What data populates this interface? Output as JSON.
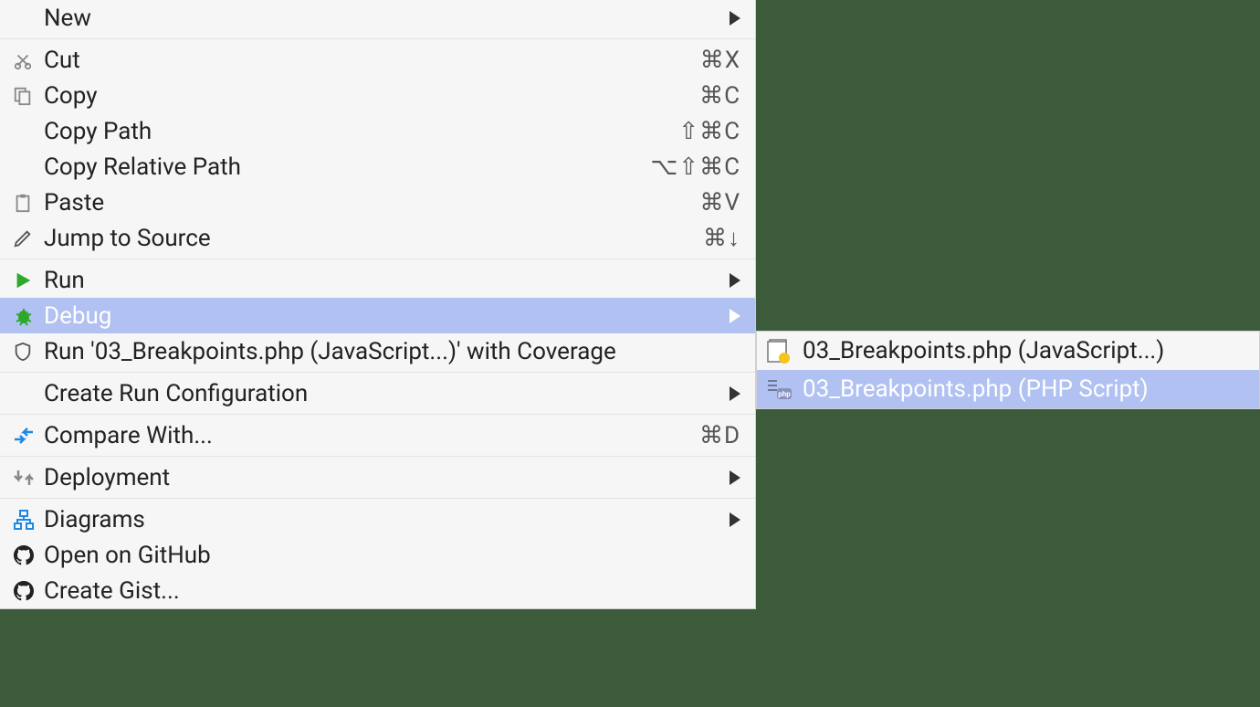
{
  "menu": {
    "new": {
      "label": "New"
    },
    "cut": {
      "label": "Cut",
      "shortcut": "⌘X"
    },
    "copy": {
      "label": "Copy",
      "shortcut": "⌘C"
    },
    "copy_path": {
      "label": "Copy Path",
      "shortcut": "⇧⌘C"
    },
    "copy_relative_path": {
      "label": "Copy Relative Path",
      "shortcut": "⌥⇧⌘C"
    },
    "paste": {
      "label": "Paste",
      "shortcut": "⌘V"
    },
    "jump_to_source": {
      "label": "Jump to Source",
      "shortcut": "⌘↓"
    },
    "run": {
      "label": "Run"
    },
    "debug": {
      "label": "Debug"
    },
    "run_with_coverage": {
      "label": "Run '03_Breakpoints.php (JavaScript...)' with Coverage"
    },
    "create_run_config": {
      "label": "Create Run Configuration"
    },
    "compare_with": {
      "label": "Compare With...",
      "shortcut": "⌘D"
    },
    "deployment": {
      "label": "Deployment"
    },
    "diagrams": {
      "label": "Diagrams"
    },
    "open_on_github": {
      "label": "Open on GitHub"
    },
    "create_gist": {
      "label": "Create Gist..."
    }
  },
  "submenu": {
    "js": {
      "label": "03_Breakpoints.php (JavaScript...)"
    },
    "php": {
      "label": "03_Breakpoints.php (PHP Script)"
    }
  }
}
